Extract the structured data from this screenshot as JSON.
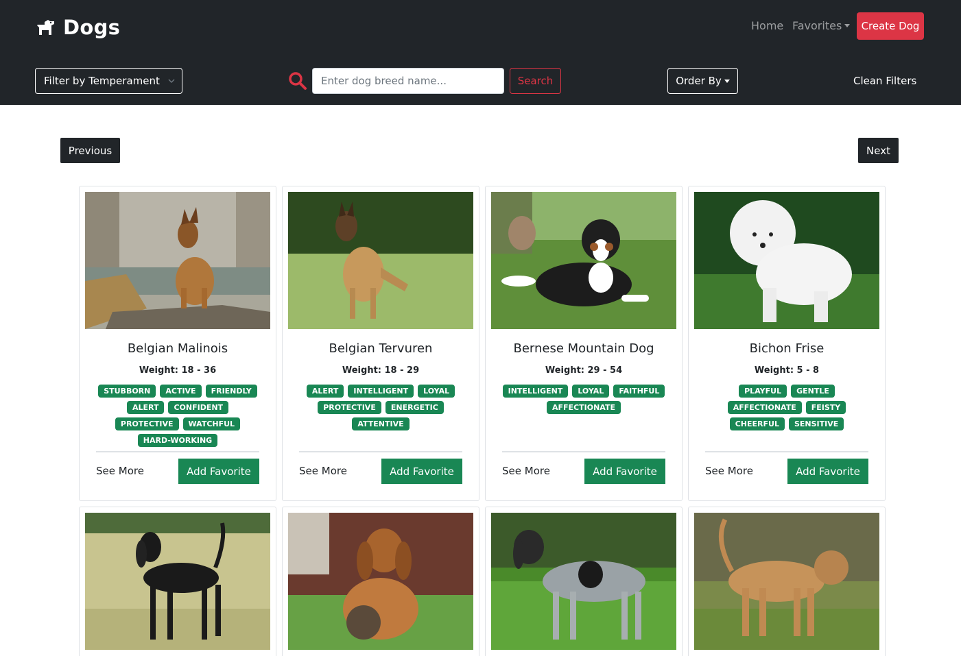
{
  "header": {
    "brand": "Dogs",
    "brand_icon": "dog-icon",
    "nav": {
      "home": "Home",
      "favorites": "Favorites"
    },
    "create_button": "Create Dog"
  },
  "toolbar": {
    "filter_temperament": "Filter by Temperament",
    "search_icon": "search-icon",
    "search_placeholder": "Enter dog breed name...",
    "search_value": "",
    "search_button": "Search",
    "order_by": "Order By",
    "clean_filters": "Clean Filters"
  },
  "pagination": {
    "previous": "Previous",
    "next": "Next"
  },
  "card_actions": {
    "see_more": "See More",
    "add_favorite": "Add Favorite"
  },
  "colors": {
    "navbar": "#212529",
    "danger": "#dc3545",
    "success": "#198754"
  },
  "dogs": [
    {
      "name": "Belgian Malinois",
      "weight": "Weight: 18 - 36",
      "temperaments": [
        "STUBBORN",
        "ACTIVE",
        "FRIENDLY",
        "ALERT",
        "CONFIDENT",
        "PROTECTIVE",
        "WATCHFUL",
        "HARD-WORKING"
      ]
    },
    {
      "name": "Belgian Tervuren",
      "weight": "Weight: 18 - 29",
      "temperaments": [
        "ALERT",
        "INTELLIGENT",
        "LOYAL",
        "PROTECTIVE",
        "ENERGETIC",
        "ATTENTIVE"
      ]
    },
    {
      "name": "Bernese Mountain Dog",
      "weight": "Weight: 29 - 54",
      "temperaments": [
        "INTELLIGENT",
        "LOYAL",
        "FAITHFUL",
        "AFFECTIONATE"
      ]
    },
    {
      "name": "Bichon Frise",
      "weight": "Weight: 5 - 8",
      "temperaments": [
        "PLAYFUL",
        "GENTLE",
        "AFFECTIONATE",
        "FEISTY",
        "CHEERFUL",
        "SENSITIVE"
      ]
    },
    {
      "name": "",
      "weight": "",
      "temperaments": []
    },
    {
      "name": "",
      "weight": "",
      "temperaments": []
    },
    {
      "name": "",
      "weight": "",
      "temperaments": []
    },
    {
      "name": "",
      "weight": "",
      "temperaments": []
    }
  ]
}
